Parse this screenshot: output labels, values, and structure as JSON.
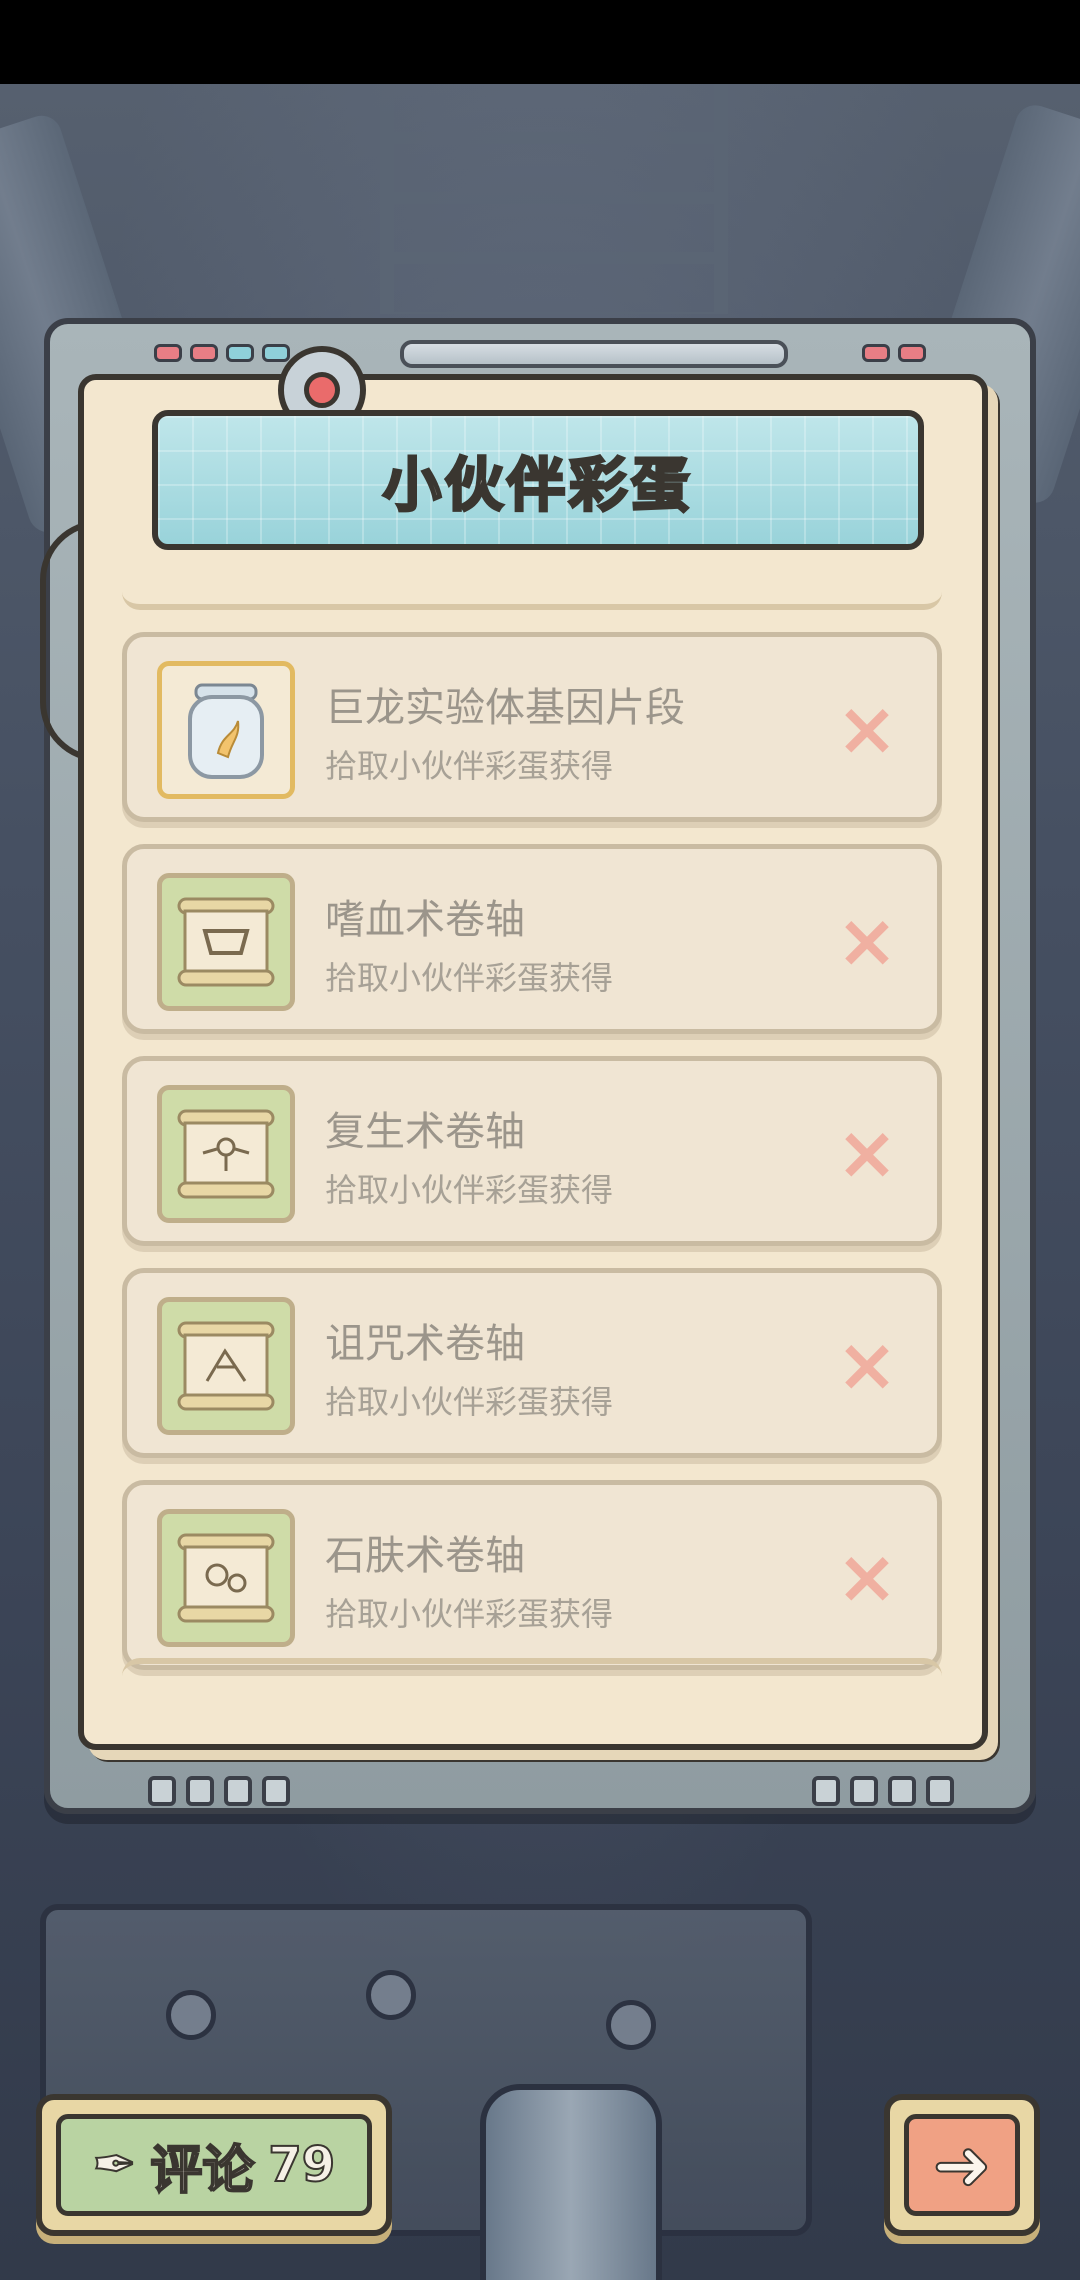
{
  "title": "小伙伴彩蛋",
  "items": [
    {
      "name": "巨龙实验体基因片段",
      "desc": "拾取小伙伴彩蛋获得",
      "icon": "dragon-gene-jar-icon",
      "frame": "gold"
    },
    {
      "name": "嗜血术卷轴",
      "desc": "拾取小伙伴彩蛋获得",
      "icon": "bloodthirst-scroll-icon",
      "frame": "green"
    },
    {
      "name": "复生术卷轴",
      "desc": "拾取小伙伴彩蛋获得",
      "icon": "revive-scroll-icon",
      "frame": "green"
    },
    {
      "name": "诅咒术卷轴",
      "desc": "拾取小伙伴彩蛋获得",
      "icon": "curse-scroll-icon",
      "frame": "green"
    },
    {
      "name": "石肤术卷轴",
      "desc": "拾取小伙伴彩蛋获得",
      "icon": "stoneskin-scroll-icon",
      "frame": "green"
    }
  ],
  "remove_icon": "×",
  "comment": {
    "label": "评论",
    "count": "79",
    "icon": "quill-icon"
  },
  "next": {
    "icon": "right-arrow-icon"
  },
  "colors": {
    "banner": "#99d3da",
    "paper": "#f3e7cf",
    "remove": "#f0b0a1",
    "comment": "#b9d3a2",
    "next": "#f0a184"
  }
}
